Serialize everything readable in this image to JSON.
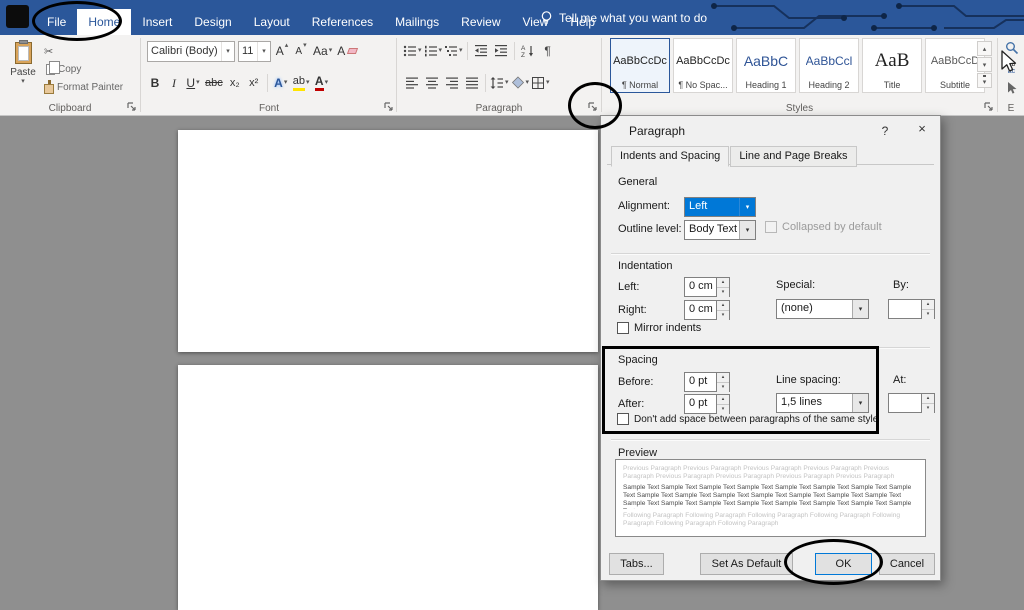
{
  "colors": {
    "titlebar": "#2b579a",
    "accent": "#0078d7",
    "annotation": "#000000",
    "heading_text": "#2f5496"
  },
  "icons": {
    "chevron": "▾",
    "spin_up": "▴",
    "spin_down": "▾",
    "pilcrow": "¶",
    "cut": "✂",
    "close": "×",
    "help": "?"
  },
  "titlebar": {
    "tabs": [
      {
        "label": "File"
      },
      {
        "label": "Home"
      },
      {
        "label": "Insert"
      },
      {
        "label": "Design"
      },
      {
        "label": "Layout"
      },
      {
        "label": "References"
      },
      {
        "label": "Mailings"
      },
      {
        "label": "Review"
      },
      {
        "label": "View"
      },
      {
        "label": "Help"
      }
    ],
    "tell_me": "Tell me what you want to do"
  },
  "ribbon": {
    "groups": {
      "clipboard": "Clipboard",
      "font": "Font",
      "paragraph": "Paragraph",
      "styles": "Styles"
    },
    "clipboard": {
      "paste": "Paste",
      "copy": "Copy",
      "format_painter": "Format Painter"
    },
    "font": {
      "family": "Calibri (Body)",
      "size": "11",
      "bold": "B",
      "italic": "I",
      "underline": "U",
      "strikethrough": "abc",
      "subscript": "x₂",
      "superscript": "x²",
      "grow": "A",
      "shrink": "A",
      "change_case": "Aa",
      "clear": "A",
      "text_effects": "A",
      "highlight": "ab",
      "font_color": "A"
    },
    "styles": [
      {
        "sample": "AaBbCcDc",
        "name": "¶ Normal"
      },
      {
        "sample": "AaBbCcDc",
        "name": "¶ No Spac..."
      },
      {
        "sample": "AaBbC",
        "name": "Heading 1"
      },
      {
        "sample": "AaBbCcl",
        "name": "Heading 2"
      },
      {
        "sample": "AaB",
        "name": "Title"
      },
      {
        "sample": "AaBbCcD",
        "name": "Subtitle"
      }
    ],
    "editing": {
      "replace_top": "ab",
      "replace_bottom": "ac",
      "label": "E"
    }
  },
  "dialog": {
    "title": "Paragraph",
    "tab_indents": "Indents and Spacing",
    "tab_breaks": "Line and Page Breaks",
    "general": {
      "heading": "General",
      "alignment_label": "Alignment:",
      "alignment_value": "Left",
      "outline_label": "Outline level:",
      "outline_value": "Body Text",
      "collapsed": "Collapsed by default"
    },
    "indentation": {
      "heading": "Indentation",
      "left_label": "Left:",
      "left_value": "0 cm",
      "right_label": "Right:",
      "right_value": "0 cm",
      "special_label": "Special:",
      "special_value": "(none)",
      "by_label": "By:",
      "mirror": "Mirror indents"
    },
    "spacing": {
      "heading": "Spacing",
      "before_label": "Before:",
      "before_value": "0 pt",
      "after_label": "After:",
      "after_value": "0 pt",
      "line_spacing_label": "Line spacing:",
      "line_spacing_value": "1,5 lines",
      "at_label": "At:",
      "dont_add": "Don't add space between paragraphs of the same style"
    },
    "preview": {
      "heading": "Preview",
      "previous": "Previous Paragraph Previous Paragraph Previous Paragraph Previous Paragraph Previous Paragraph Previous Paragraph Previous Paragraph Previous Paragraph Previous Paragraph Previous Paragraph Previous Paragraph Previous Paragraph",
      "sample": "Sample Text Sample Text Sample Text Sample Text Sample Text Sample Text Sample Text Sample Text Sample Text Sample Text Sample Text Sample Text Sample Text Sample Text Sample Text Sample Text Sample Text Sample Text Sample Text Sample Text Sample Text Sample Text Sample Text",
      "following": "Following Paragraph Following Paragraph Following Paragraph Following Paragraph Following Paragraph Following Paragraph Following Paragraph"
    },
    "buttons": {
      "tabs": "Tabs...",
      "set_default": "Set As Default",
      "ok": "OK",
      "cancel": "Cancel"
    }
  }
}
